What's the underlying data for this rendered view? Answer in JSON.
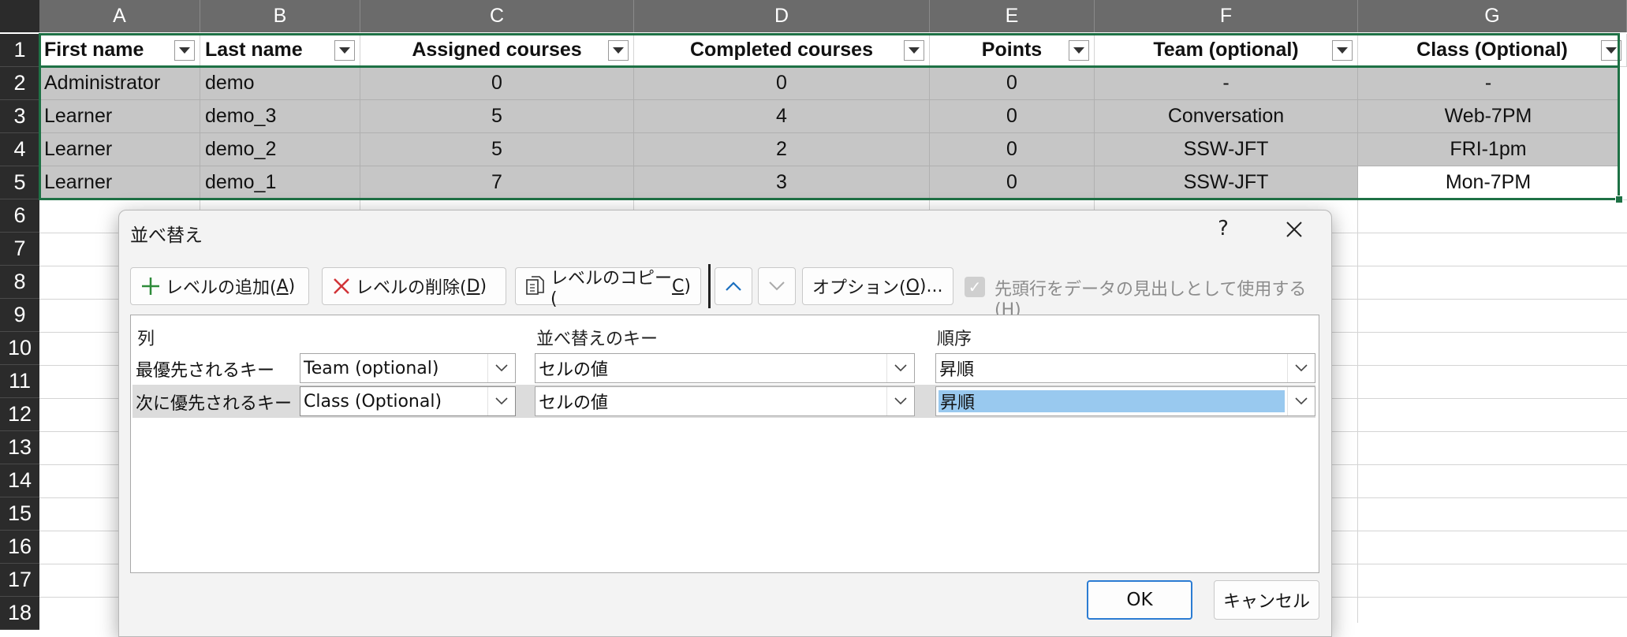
{
  "sheet": {
    "columns": [
      "A",
      "B",
      "C",
      "D",
      "E",
      "F",
      "G"
    ],
    "rows": [
      "1",
      "2",
      "3",
      "4",
      "5",
      "6",
      "7",
      "8",
      "9",
      "10",
      "11",
      "12",
      "13",
      "14",
      "15",
      "16",
      "17",
      "18"
    ],
    "headers": [
      "First name",
      "Last name",
      "Assigned courses",
      "Completed courses",
      "Points",
      "Team (optional)",
      "Class (Optional)"
    ],
    "data": [
      [
        "Administrator",
        "demo",
        "0",
        "0",
        "0",
        "-",
        "-"
      ],
      [
        "Learner",
        "demo_3",
        "5",
        "4",
        "0",
        "Conversation",
        "Web-7PM"
      ],
      [
        "Learner",
        "demo_2",
        "5",
        "2",
        "0",
        "SSW-JFT",
        "FRI-1pm"
      ],
      [
        "Learner",
        "demo_1",
        "7",
        "3",
        "0",
        "SSW-JFT",
        "Mon-7PM"
      ]
    ],
    "colors": {
      "selection_fill": "#c6c6c6",
      "selection_border": "#1e7145",
      "header_bg": "#6b6b6b"
    }
  },
  "dialog": {
    "title": "並べ替え",
    "help": "?",
    "close_icon": "close-icon",
    "toolbar": {
      "add_level": "レベルの追加(",
      "add_level_key": "A",
      "delete_level": "レベルの削除(",
      "delete_level_key": "D",
      "copy_level": "レベルのコピー(",
      "copy_level_key": "C",
      "options": "オプション(",
      "options_key": "O",
      "options_suffix": ")...",
      "close_paren": ")",
      "header_checkbox_label": "先頭行をデータの見出しとして使用する(",
      "header_checkbox_key": "H",
      "header_checkbox_checked": true
    },
    "list": {
      "col_header": "列",
      "key_header": "並べ替えのキー",
      "order_header": "順序",
      "levels": [
        {
          "label": "最優先されるキー",
          "column": "Team (optional)",
          "key": "セルの値",
          "order": "昇順"
        },
        {
          "label": "次に優先されるキー",
          "column": "Class (Optional)",
          "key": "セルの値",
          "order": "昇順"
        }
      ]
    },
    "ok": "OK",
    "cancel": "キャンセル"
  }
}
